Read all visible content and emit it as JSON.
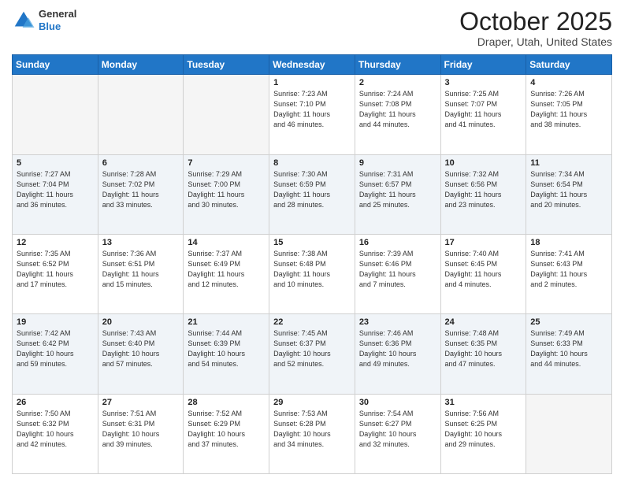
{
  "header": {
    "logo": {
      "general": "General",
      "blue": "Blue"
    },
    "title": "October 2025",
    "location": "Draper, Utah, United States"
  },
  "days_of_week": [
    "Sunday",
    "Monday",
    "Tuesday",
    "Wednesday",
    "Thursday",
    "Friday",
    "Saturday"
  ],
  "weeks": [
    [
      {
        "day": "",
        "info": ""
      },
      {
        "day": "",
        "info": ""
      },
      {
        "day": "",
        "info": ""
      },
      {
        "day": "1",
        "info": "Sunrise: 7:23 AM\nSunset: 7:10 PM\nDaylight: 11 hours\nand 46 minutes."
      },
      {
        "day": "2",
        "info": "Sunrise: 7:24 AM\nSunset: 7:08 PM\nDaylight: 11 hours\nand 44 minutes."
      },
      {
        "day": "3",
        "info": "Sunrise: 7:25 AM\nSunset: 7:07 PM\nDaylight: 11 hours\nand 41 minutes."
      },
      {
        "day": "4",
        "info": "Sunrise: 7:26 AM\nSunset: 7:05 PM\nDaylight: 11 hours\nand 38 minutes."
      }
    ],
    [
      {
        "day": "5",
        "info": "Sunrise: 7:27 AM\nSunset: 7:04 PM\nDaylight: 11 hours\nand 36 minutes."
      },
      {
        "day": "6",
        "info": "Sunrise: 7:28 AM\nSunset: 7:02 PM\nDaylight: 11 hours\nand 33 minutes."
      },
      {
        "day": "7",
        "info": "Sunrise: 7:29 AM\nSunset: 7:00 PM\nDaylight: 11 hours\nand 30 minutes."
      },
      {
        "day": "8",
        "info": "Sunrise: 7:30 AM\nSunset: 6:59 PM\nDaylight: 11 hours\nand 28 minutes."
      },
      {
        "day": "9",
        "info": "Sunrise: 7:31 AM\nSunset: 6:57 PM\nDaylight: 11 hours\nand 25 minutes."
      },
      {
        "day": "10",
        "info": "Sunrise: 7:32 AM\nSunset: 6:56 PM\nDaylight: 11 hours\nand 23 minutes."
      },
      {
        "day": "11",
        "info": "Sunrise: 7:34 AM\nSunset: 6:54 PM\nDaylight: 11 hours\nand 20 minutes."
      }
    ],
    [
      {
        "day": "12",
        "info": "Sunrise: 7:35 AM\nSunset: 6:52 PM\nDaylight: 11 hours\nand 17 minutes."
      },
      {
        "day": "13",
        "info": "Sunrise: 7:36 AM\nSunset: 6:51 PM\nDaylight: 11 hours\nand 15 minutes."
      },
      {
        "day": "14",
        "info": "Sunrise: 7:37 AM\nSunset: 6:49 PM\nDaylight: 11 hours\nand 12 minutes."
      },
      {
        "day": "15",
        "info": "Sunrise: 7:38 AM\nSunset: 6:48 PM\nDaylight: 11 hours\nand 10 minutes."
      },
      {
        "day": "16",
        "info": "Sunrise: 7:39 AM\nSunset: 6:46 PM\nDaylight: 11 hours\nand 7 minutes."
      },
      {
        "day": "17",
        "info": "Sunrise: 7:40 AM\nSunset: 6:45 PM\nDaylight: 11 hours\nand 4 minutes."
      },
      {
        "day": "18",
        "info": "Sunrise: 7:41 AM\nSunset: 6:43 PM\nDaylight: 11 hours\nand 2 minutes."
      }
    ],
    [
      {
        "day": "19",
        "info": "Sunrise: 7:42 AM\nSunset: 6:42 PM\nDaylight: 10 hours\nand 59 minutes."
      },
      {
        "day": "20",
        "info": "Sunrise: 7:43 AM\nSunset: 6:40 PM\nDaylight: 10 hours\nand 57 minutes."
      },
      {
        "day": "21",
        "info": "Sunrise: 7:44 AM\nSunset: 6:39 PM\nDaylight: 10 hours\nand 54 minutes."
      },
      {
        "day": "22",
        "info": "Sunrise: 7:45 AM\nSunset: 6:37 PM\nDaylight: 10 hours\nand 52 minutes."
      },
      {
        "day": "23",
        "info": "Sunrise: 7:46 AM\nSunset: 6:36 PM\nDaylight: 10 hours\nand 49 minutes."
      },
      {
        "day": "24",
        "info": "Sunrise: 7:48 AM\nSunset: 6:35 PM\nDaylight: 10 hours\nand 47 minutes."
      },
      {
        "day": "25",
        "info": "Sunrise: 7:49 AM\nSunset: 6:33 PM\nDaylight: 10 hours\nand 44 minutes."
      }
    ],
    [
      {
        "day": "26",
        "info": "Sunrise: 7:50 AM\nSunset: 6:32 PM\nDaylight: 10 hours\nand 42 minutes."
      },
      {
        "day": "27",
        "info": "Sunrise: 7:51 AM\nSunset: 6:31 PM\nDaylight: 10 hours\nand 39 minutes."
      },
      {
        "day": "28",
        "info": "Sunrise: 7:52 AM\nSunset: 6:29 PM\nDaylight: 10 hours\nand 37 minutes."
      },
      {
        "day": "29",
        "info": "Sunrise: 7:53 AM\nSunset: 6:28 PM\nDaylight: 10 hours\nand 34 minutes."
      },
      {
        "day": "30",
        "info": "Sunrise: 7:54 AM\nSunset: 6:27 PM\nDaylight: 10 hours\nand 32 minutes."
      },
      {
        "day": "31",
        "info": "Sunrise: 7:56 AM\nSunset: 6:25 PM\nDaylight: 10 hours\nand 29 minutes."
      },
      {
        "day": "",
        "info": ""
      }
    ]
  ]
}
